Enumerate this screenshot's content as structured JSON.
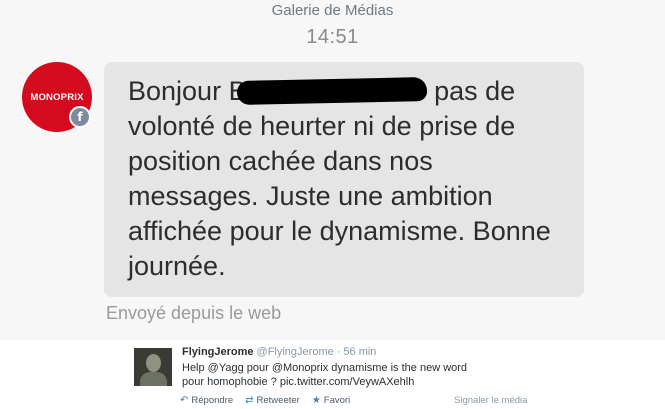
{
  "header": {
    "gallery_link": "Galerie de Médias",
    "timestamp": "14:51"
  },
  "sender": {
    "avatar_text": "MONOPRIX",
    "badge": "f"
  },
  "message": {
    "line_start": "Bonjour B",
    "text_after_redaction": "pas de volonté de heurter ni de prise de position cachée dans nos messages. Juste une ambition affichée pour le dynamisme. Bonne journée.",
    "sent_via": "Envoyé depuis le web"
  },
  "tweet": {
    "author_name": "FlyingJerome",
    "author_handle": "@FlyingJerome",
    "separator": "·",
    "time": "56 min",
    "text": "Help @Yagg pour @Monoprix dynamisme is the new word pour homophobie ? pic.twitter.com/VeywAXehlh",
    "actions": {
      "reply": "Répondre",
      "retweet": "Retweeter",
      "favorite": "Favori"
    },
    "report_media": "Signaler le média"
  },
  "icons": {
    "reply": "reply-arrow-icon",
    "retweet": "retweet-icon",
    "favorite": "star-icon"
  },
  "colors": {
    "brand_red": "#d40b1f",
    "bubble_gray": "#e5e5e5",
    "link_blue": "#3b88c3"
  }
}
